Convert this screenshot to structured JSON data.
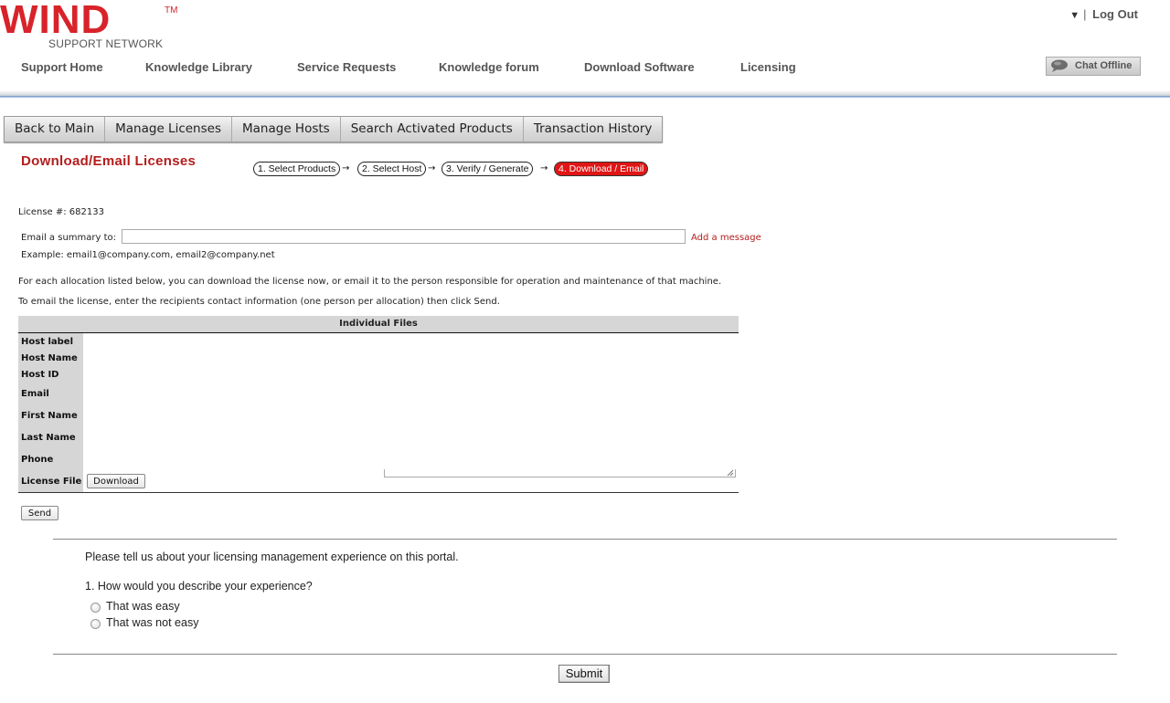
{
  "brand": {
    "name": "WIND",
    "tm": "TM",
    "sub": "SUPPORT NETWORK",
    "color": "#d8232a"
  },
  "account": {
    "menu_arrow": "▼",
    "separator": "|",
    "logout_label": "Log Out"
  },
  "nav": {
    "items": [
      "Support Home",
      "Knowledge Library",
      "Service Requests",
      "Knowledge forum",
      "Download Software",
      "Licensing"
    ],
    "chat_label": "Chat Offline"
  },
  "tabs": [
    "Back to Main",
    "Manage Licenses",
    "Manage Hosts",
    "Search Activated Products",
    "Transaction History"
  ],
  "page": {
    "title": "Download/Email Licenses"
  },
  "steps": [
    {
      "label": "1. Select Products",
      "active": false
    },
    {
      "label": "2. Select Host",
      "active": false
    },
    {
      "label": "3. Verify / Generate",
      "active": false
    },
    {
      "label": "4. Download / Email",
      "active": true
    }
  ],
  "license": {
    "number_line": "License #: 682133",
    "email_label": "Email a summary to:",
    "email_value": "",
    "add_message": "Add a message",
    "example": "Example: email1@company.com, email2@company.net",
    "instructions_1": "For each allocation listed below, you can download the license now, or email it to the person responsible for operation and maintenance of that machine.",
    "instructions_2": "To email the license, enter the recipients contact information (one person per allocation) then click Send."
  },
  "files_table": {
    "header": "Individual Files",
    "rows": [
      "Host label",
      "Host Name",
      "Host ID",
      "Email",
      "First Name",
      "Last Name",
      "Phone",
      "License File"
    ],
    "download_label": "Download",
    "send_label": "Send"
  },
  "survey": {
    "intro": "Please tell us about your licensing management experience on this portal.",
    "question": "1. How would you describe your experience?",
    "options": [
      "That was easy",
      "That was not easy"
    ],
    "submit_label": "Submit"
  }
}
